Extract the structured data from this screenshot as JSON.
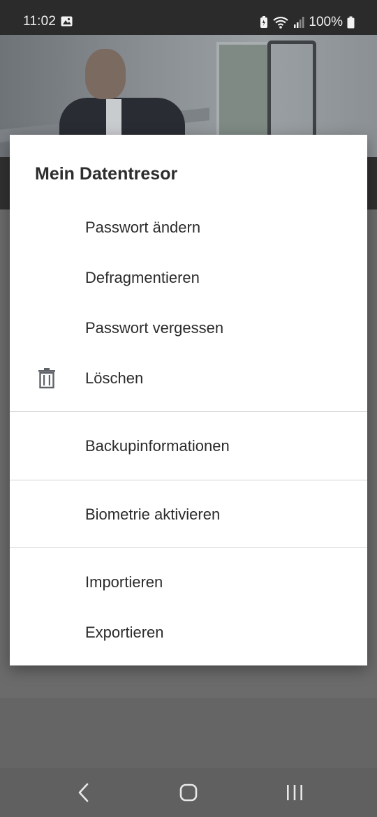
{
  "status_bar": {
    "time": "11:02",
    "battery_percent": "100%"
  },
  "dialog": {
    "title": "Mein Datentresor",
    "groups": [
      [
        {
          "label": "Passwort ändern",
          "icon": null
        },
        {
          "label": "Defragmentieren",
          "icon": null
        },
        {
          "label": "Passwort vergessen",
          "icon": null
        },
        {
          "label": "Löschen",
          "icon": "trash-icon"
        }
      ],
      [
        {
          "label": "Backupinformationen",
          "icon": null
        }
      ],
      [
        {
          "label": "Biometrie aktivieren",
          "icon": null
        }
      ],
      [
        {
          "label": "Importieren",
          "icon": null
        },
        {
          "label": "Exportieren",
          "icon": null
        }
      ]
    ]
  },
  "colors": {
    "dialog_background": "#ffffff",
    "scrim": "#6b6b6b",
    "text": "#2b2b2b",
    "divider": "#d4d4d4"
  }
}
